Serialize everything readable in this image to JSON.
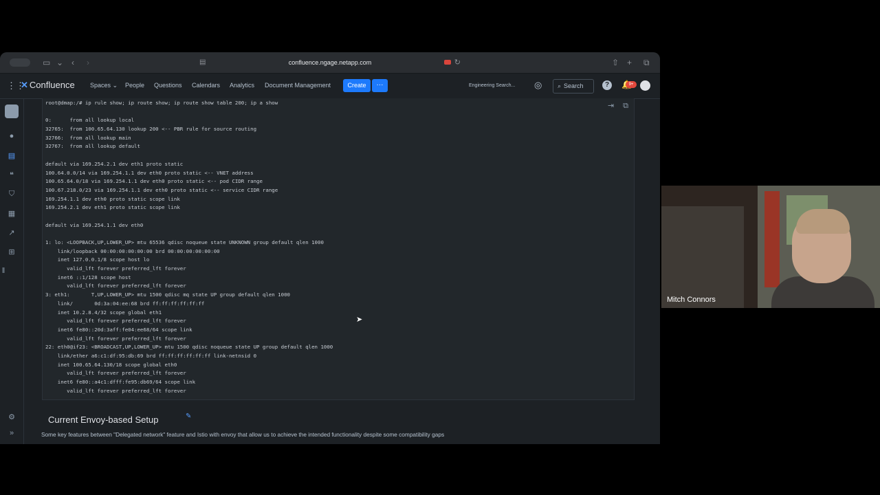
{
  "browser": {
    "url": "confluence.ngage.netapp.com"
  },
  "confluence_nav": {
    "logo_text": "Confluence",
    "items": [
      "Spaces",
      "People",
      "Questions",
      "Calendars",
      "Analytics",
      "Document Management"
    ],
    "create_label": "Create",
    "more_label": "···",
    "engineering_search": "Engineering Search...",
    "search_label": "Search",
    "help_label": "?",
    "notification_count": "9+"
  },
  "code_block": {
    "lines": [
      "root@dmap:/# ip rule show; ip route show; ip route show table 200; ip a show",
      "",
      "0:      from all lookup local",
      "32765:  from 100.65.64.130 lookup 200 <-- PBR rule for source routing",
      "32766:  from all lookup main",
      "32767:  from all lookup default",
      "",
      "default via 169.254.2.1 dev eth1 proto static",
      "100.64.0.0/14 via 169.254.1.1 dev eth0 proto static <-- VNET address",
      "100.65.64.0/18 via 169.254.1.1 dev eth0 proto static <-- pod CIDR range",
      "100.67.218.0/23 via 169.254.1.1 dev eth0 proto static <-- service CIDR range",
      "169.254.1.1 dev eth0 proto static scope link",
      "169.254.2.1 dev eth1 proto static scope link",
      "",
      "default via 169.254.1.1 dev eth0",
      "",
      "1: lo: <LOOPBACK,UP,LOWER_UP> mtu 65536 qdisc noqueue state UNKNOWN group default qlen 1000",
      "    link/loopback 00:00:00:00:00:00 brd 00:00:00:00:00:00",
      "    inet 127.0.0.1/8 scope host lo",
      "       valid_lft forever preferred_lft forever",
      "    inet6 ::1/128 scope host",
      "       valid_lft forever preferred_lft forever",
      "3: eth1:       T,UP,LOWER_UP> mtu 1500 qdisc mq state UP group default qlen 1000",
      "    link/       0d:3a:04:ee:68 brd ff:ff:ff:ff:ff:ff",
      "    inet 10.2.8.4/32 scope global eth1",
      "       valid_lft forever preferred_lft forever",
      "    inet6 fe80::20d:3aff:fe04:ee68/64 scope link",
      "       valid_lft forever preferred_lft forever",
      "22: eth0@if23: <BROADCAST,UP,LOWER_UP> mtu 1500 qdisc noqueue state UP group default qlen 1000",
      "    link/ether a6:c1:df:95:db:69 brd ff:ff:ff:ff:ff:ff link-netnsid 0",
      "    inet 100.65.64.130/18 scope global eth0",
      "       valid_lft forever preferred_lft forever",
      "    inet6 fe80::a4c1:dfff:fe95:db69/64 scope link",
      "       valid_lft forever preferred_lft forever"
    ]
  },
  "section": {
    "title": "Current Envoy-based Setup",
    "description": "Some key features between \"Delegated network\" feature and Istio with envoy that allow us to achieve the intended functionality despite some compatibility gaps"
  },
  "video": {
    "participant_name": "Mitch Connors"
  },
  "colors": {
    "accent": "#1d7afc",
    "background": "#1d2125",
    "code_background": "#22272b",
    "keyword": "#579dff"
  }
}
